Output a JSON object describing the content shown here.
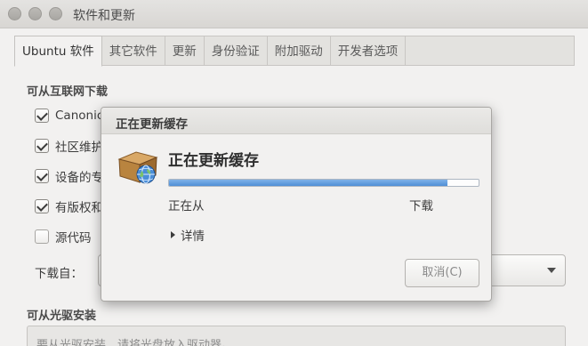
{
  "window": {
    "title": "软件和更新"
  },
  "tabs": [
    {
      "label": "Ubuntu 软件",
      "active": true
    },
    {
      "label": "其它软件",
      "active": false
    },
    {
      "label": "更新",
      "active": false
    },
    {
      "label": "身份验证",
      "active": false
    },
    {
      "label": "附加驱动",
      "active": false
    },
    {
      "label": "开发者选项",
      "active": false
    }
  ],
  "internet_section": {
    "title": "可从互联网下载",
    "items": [
      {
        "label": "Canonic",
        "checked": true
      },
      {
        "label": "社区维护",
        "checked": true
      },
      {
        "label": "设备的专",
        "checked": true
      },
      {
        "label": "有版权和",
        "checked": true
      },
      {
        "label": "源代码",
        "checked": false
      }
    ],
    "download_from_label": "下载自："
  },
  "cdrom_section": {
    "title": "可从光驱安装",
    "placeholder": "要从光驱安装，请将光盘放入驱动器。"
  },
  "dialog": {
    "title": "正在更新缓存",
    "heading": "正在更新缓存",
    "progress_fraction": 0.9,
    "status_left": "正在从",
    "status_right": "下载",
    "details_label": "详情",
    "cancel_label": "取消(C)",
    "icon": "package-globe-icon"
  },
  "colors": {
    "window_bg": "#f2f1f0",
    "progress_fill": "#5a98dc",
    "checkbox_check": "#3b3b3b"
  }
}
